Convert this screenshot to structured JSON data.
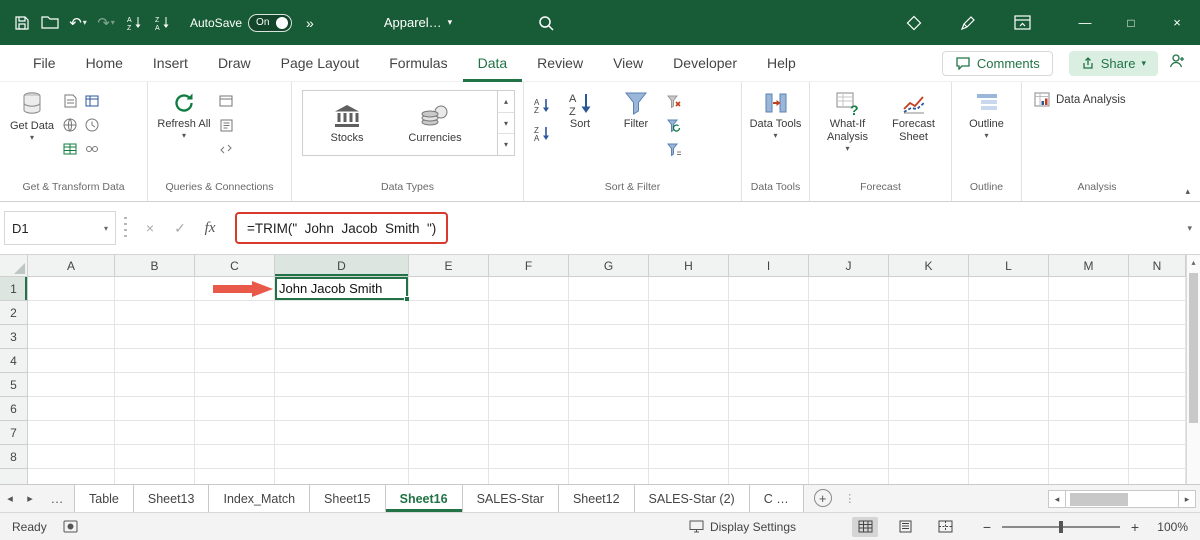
{
  "colors": {
    "titlebar_green": "#185C37",
    "accent_green": "#217346",
    "ribbon_green": "#107C41",
    "arrow_red": "#E8594A",
    "formula_highlight_red": "#D8392B"
  },
  "icons": {
    "chevron_down": "▾",
    "chevron_up": "▴",
    "scroll_left": "◂",
    "scroll_right": "▸",
    "ellipsis": "…",
    "undo": "↶",
    "redo": "↷",
    "more_chevrons": "»",
    "minimize": "—",
    "maximize": "□",
    "close": "×",
    "grip_dots": "⋮"
  },
  "titlebar": {
    "autosave_label": "AutoSave",
    "autosave_state": "On",
    "doc_name": "Apparel…"
  },
  "ribbon": {
    "tabs": [
      "File",
      "Home",
      "Insert",
      "Draw",
      "Page Layout",
      "Formulas",
      "Data",
      "Review",
      "View",
      "Developer",
      "Help"
    ],
    "active_tab": "Data",
    "comments_label": "Comments",
    "share_label": "Share",
    "groups": {
      "get_transform": {
        "label": "Get & Transform Data",
        "get_data": "Get Data"
      },
      "queries": {
        "label": "Queries & Connections",
        "refresh_all": "Refresh All"
      },
      "data_types": {
        "label": "Data Types",
        "stocks": "Stocks",
        "currencies": "Currencies"
      },
      "sort_filter": {
        "label": "Sort & Filter",
        "sort": "Sort",
        "filter": "Filter"
      },
      "data_tools": {
        "label": "Data Tools",
        "button": "Data Tools"
      },
      "forecast": {
        "label": "Forecast",
        "what_if": "What-If Analysis",
        "forecast_sheet": "Forecast Sheet"
      },
      "outline": {
        "label": "Outline",
        "button": "Outline"
      },
      "analysis": {
        "label": "Analysis",
        "data_analysis": "Data Analysis"
      }
    }
  },
  "formula_bar": {
    "name_box": "D1",
    "cancel_glyph": "×",
    "enter_glyph": "✓",
    "fx_label": "fx",
    "formula": "=TRIM(\"  John  Jacob  Smith  \")"
  },
  "grid": {
    "columns": [
      "A",
      "B",
      "C",
      "D",
      "E",
      "F",
      "G",
      "H",
      "I",
      "J",
      "K",
      "L",
      "M",
      "N"
    ],
    "rows": [
      "1",
      "2",
      "3",
      "4",
      "5",
      "6",
      "7",
      "8"
    ],
    "selected": {
      "cell": "D1",
      "column": "D",
      "row": "1",
      "value": "John Jacob Smith"
    }
  },
  "sheet_tabs": {
    "tabs": [
      "Table",
      "Sheet13",
      "Index_Match",
      "Sheet15",
      "Sheet16",
      "SALES-Star",
      "Sheet12",
      "SALES-Star (2)",
      "C …"
    ],
    "active": "Sheet16",
    "add_label": "+"
  },
  "status_bar": {
    "ready_label": "Ready",
    "display_settings_label": "Display Settings",
    "zoom_out_glyph": "−",
    "zoom_in_glyph": "+",
    "zoom_level": "100%"
  }
}
